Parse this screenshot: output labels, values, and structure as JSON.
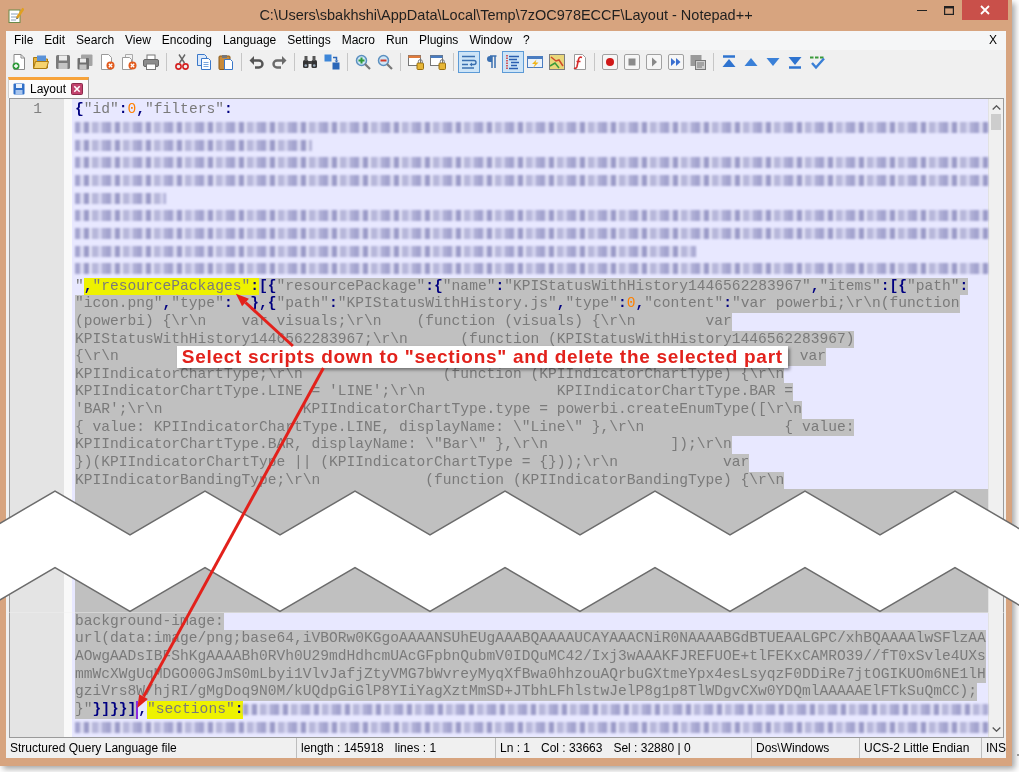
{
  "window": {
    "title": "C:\\Users\\sbakhshi\\AppData\\Local\\Temp\\7zOC978ECCF\\Layout - Notepad++"
  },
  "menu": {
    "items": [
      "File",
      "Edit",
      "Search",
      "View",
      "Encoding",
      "Language",
      "Settings",
      "Macro",
      "Run",
      "Plugins",
      "Window",
      "?"
    ],
    "close": "X"
  },
  "toolbar": [
    {
      "kind": "new",
      "on": false
    },
    {
      "kind": "open",
      "on": false
    },
    {
      "kind": "save",
      "on": false
    },
    {
      "kind": "save_all",
      "on": false
    },
    {
      "kind": "close",
      "on": false
    },
    {
      "kind": "close_all",
      "on": false
    },
    {
      "kind": "print",
      "on": false
    },
    {
      "kind": "separator"
    },
    {
      "kind": "cut",
      "on": false
    },
    {
      "kind": "copy",
      "on": false
    },
    {
      "kind": "paste",
      "on": false
    },
    {
      "kind": "separator"
    },
    {
      "kind": "undo",
      "on": false
    },
    {
      "kind": "redo",
      "on": false
    },
    {
      "kind": "separator"
    },
    {
      "kind": "find",
      "on": false
    },
    {
      "kind": "replace",
      "on": false
    },
    {
      "kind": "separator"
    },
    {
      "kind": "zoom_in",
      "on": false
    },
    {
      "kind": "zoom_out",
      "on": false
    },
    {
      "kind": "separator"
    },
    {
      "kind": "sync_vertical",
      "on": false
    },
    {
      "kind": "sync_horizontal",
      "on": false
    },
    {
      "kind": "separator"
    },
    {
      "kind": "word_wrap",
      "on": true
    },
    {
      "kind": "all_chars",
      "on": false
    },
    {
      "kind": "indent_guide",
      "on": true
    },
    {
      "kind": "user_language",
      "on": false
    },
    {
      "kind": "document_map",
      "on": false
    },
    {
      "kind": "function_list",
      "on": false
    },
    {
      "kind": "separator"
    },
    {
      "kind": "record",
      "on": false
    },
    {
      "kind": "stop",
      "on": false
    },
    {
      "kind": "play",
      "on": false
    },
    {
      "kind": "play_multiple",
      "on": false
    },
    {
      "kind": "save_macro",
      "on": false
    },
    {
      "kind": "separator"
    },
    {
      "kind": "first",
      "on": false
    },
    {
      "kind": "previous",
      "on": false
    },
    {
      "kind": "next",
      "on": false
    },
    {
      "kind": "last",
      "on": false
    },
    {
      "kind": "spell_check"
    }
  ],
  "tabs": [
    {
      "label": "Layout",
      "selected": true
    }
  ],
  "editor": {
    "line_numbers": [
      "1"
    ],
    "rows": [
      {
        "kind": "code",
        "segments": [
          {
            "text": "{\"id\":0,\"filters\":",
            "kind": "json",
            "selected": false,
            "highlight": false
          }
        ]
      },
      {
        "kind": "code",
        "segments": [
          {
            "kind": "blurred",
            "level": 1
          }
        ]
      },
      {
        "kind": "code",
        "segments": [
          {
            "kind": "blurred",
            "level": 0.26
          }
        ]
      },
      {
        "kind": "code",
        "segments": [
          {
            "kind": "blurred",
            "level": 1
          }
        ]
      },
      {
        "kind": "code",
        "segments": [
          {
            "kind": "blurred",
            "level": 1
          }
        ]
      },
      {
        "kind": "code",
        "segments": [
          {
            "kind": "blurred",
            "level": 0.1
          }
        ]
      },
      {
        "kind": "code",
        "segments": [
          {
            "kind": "blurred",
            "level": 1
          }
        ]
      },
      {
        "kind": "code",
        "segments": [
          {
            "kind": "blurred",
            "level": 1
          }
        ]
      },
      {
        "kind": "code",
        "segments": [
          {
            "kind": "blurred",
            "level": 0.68
          }
        ]
      },
      {
        "kind": "code",
        "segments": [
          {
            "kind": "blurred",
            "level": 1
          }
        ]
      },
      {
        "kind": "code",
        "segments": [
          {
            "text": "\"",
            "kind": "string",
            "selected": false,
            "highlight": false
          },
          {
            "text": ",\"resourcePackages\":",
            "kind": "json",
            "selected": false,
            "highlight": true
          },
          {
            "text": "[{\"resourcePackage\":{\"name\":\"KPIStatusWithHistory1446562283967\",\"items\":[{\"path\":",
            "kind": "json",
            "selected": true,
            "highlight": false
          }
        ]
      },
      {
        "kind": "code",
        "segments": [
          {
            "text": "\"icon.png\",\"type\":  },{\"path\":\"KPIStatusWithHistory.js\",\"type\":0,\"content\":\"var powerbi;\\r\\n(function",
            "kind": "json",
            "selected": true,
            "highlight": false
          }
        ]
      },
      {
        "kind": "code",
        "segments": [
          {
            "text": "(powerbi) {\\r\\n    var visuals;\\r\\n    (function (visuals) {\\r\\n        var",
            "kind": "string",
            "selected": true,
            "highlight": false
          }
        ]
      },
      {
        "kind": "code",
        "segments": [
          {
            "text": "KPIStatusWithHistory1446562283967;\\r\\n      (function (KPIStatusWithHistory1446562283967)",
            "kind": "string",
            "selected": true,
            "highlight": false
          }
        ]
      },
      {
        "kind": "note",
        "segments": [
          {
            "text": "{\\r\\n",
            "kind": "string",
            "selected": true,
            "highlight": false
          }
        ],
        "note": "Select scripts down to \"sections\" and delete the selected part",
        "after": [
          {
            "text": "var",
            "kind": "string",
            "selected": true,
            "highlight": false
          }
        ]
      },
      {
        "kind": "code",
        "segments": [
          {
            "text": "KPIIndicatorChartType;\\r\\n                (function (KPIIndicatorChartType) {\\r\\n",
            "kind": "string",
            "selected": true,
            "highlight": false
          }
        ]
      },
      {
        "kind": "code",
        "segments": [
          {
            "text": "KPIIndicatorChartType.LINE = 'LINE';\\r\\n               KPIIndicatorChartType.BAR =",
            "kind": "string",
            "selected": true,
            "highlight": false
          }
        ]
      },
      {
        "kind": "code",
        "segments": [
          {
            "text": "'BAR';\\r\\n                KPIIndicatorChartType.type = powerbi.createEnumType([\\r\\n",
            "kind": "string",
            "selected": true,
            "highlight": false
          }
        ]
      },
      {
        "kind": "code",
        "segments": [
          {
            "text": "{ value: KPIIndicatorChartType.LINE, displayName: \\\"Line\\\" },\\r\\n                { value:",
            "kind": "string",
            "selected": true,
            "highlight": false
          }
        ]
      },
      {
        "kind": "code",
        "segments": [
          {
            "text": "KPIIndicatorChartType.BAR, displayName: \\\"Bar\\\" },\\r\\n              ]);\\r\\n",
            "kind": "string",
            "selected": true,
            "highlight": false
          }
        ]
      },
      {
        "kind": "code",
        "segments": [
          {
            "text": "})(KPIIndicatorChartType || (KPIIndicatorChartType = {}));\\r\\n            var",
            "kind": "string",
            "selected": true,
            "highlight": false
          }
        ]
      },
      {
        "kind": "code",
        "segments": [
          {
            "text": "KPIIndicatorBandingType;\\r\\n            (function (KPIIndicatorBandingType) {\\r\\n",
            "kind": "string",
            "selected": true,
            "highlight": false
          }
        ]
      },
      {
        "kind": "tear"
      },
      {
        "kind": "code",
        "segments": [
          {
            "text": "background-image:",
            "kind": "string",
            "selected": true,
            "highlight": false
          }
        ]
      },
      {
        "kind": "code",
        "segments": [
          {
            "text": "url(data:image/png;base64,iVBORw0KGgoAAAANSUhEUgAAABQAAAAUCAYAAACNiR0NAAAABGdBTUEAALGPC/xhBQAAAAlwSFlzAA",
            "kind": "string",
            "selected": true,
            "highlight": false
          }
        ]
      },
      {
        "kind": "code",
        "segments": [
          {
            "text": "AOwgAADsIBFShKgAAAABh0RVh0U29mdHdhcmUAcGFpbnQubmV0IDQuMC42/Ixj3wAAAKFJREFUOE+tlFEKxCAMRO39//fT0xSvle4UXs",
            "kind": "string",
            "selected": true,
            "highlight": false
          }
        ]
      },
      {
        "kind": "code",
        "segments": [
          {
            "text": "mmWcXWgUqMDGO00GJmS0mLbyi1VlvJafjZtyVMG7bWvreyMyqXfBwa0hhzouAQrbuGXtmeYpx4esLsyqzF0DDiRe7jtOGIKUOm6NE1lH",
            "kind": "string",
            "selected": true,
            "highlight": false
          }
        ]
      },
      {
        "kind": "code",
        "segments": [
          {
            "text": "gziVrs8W/hjRI/gMgDoq9N0M/kUQdpGiGlP8YIiYagXztMmSD+JTbhLFhlstwJelP8g1p8TlWDgvCXw0YDQmlAAAAAElFTkSuQmCC);",
            "kind": "string",
            "selected": true,
            "highlight": false
          }
        ]
      },
      {
        "kind": "code",
        "segments": [
          {
            "text": "}\"",
            "kind": "string",
            "selected": true,
            "highlight": false
          },
          {
            "text": "}]}}]",
            "kind": "json",
            "selected": true,
            "highlight": false
          },
          {
            "kind": "caret"
          },
          {
            "text": ",",
            "kind": "json",
            "selected": false,
            "highlight": false
          },
          {
            "text": "\"sections\":",
            "kind": "json",
            "selected": false,
            "highlight": true
          },
          {
            "kind": "blurred"
          }
        ]
      },
      {
        "kind": "code",
        "segments": [
          {
            "kind": "blurred",
            "level": 1
          }
        ]
      }
    ]
  },
  "status_bar": {
    "sections": [
      [
        "Structured Query Language file"
      ],
      [
        "length : 145918",
        "lines : 1"
      ],
      [
        "Ln : 1",
        "Col : 33663",
        "Sel : 32880 | 0"
      ],
      [
        "Dos\\Windows"
      ],
      [
        "UCS-2 Little Endian"
      ],
      [
        "INS"
      ]
    ]
  }
}
